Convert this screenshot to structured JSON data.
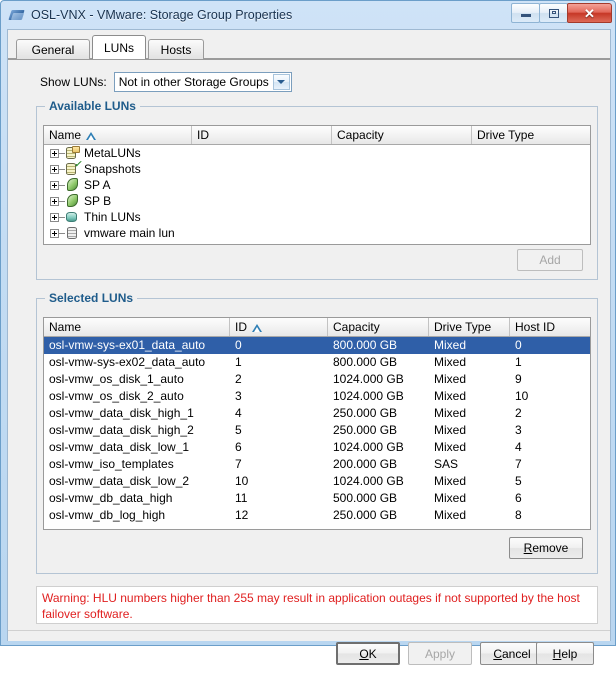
{
  "window": {
    "title": "OSL-VNX - VMware: Storage Group Properties",
    "icon": "vmware-app-icon",
    "controls": {
      "minimize": "minimize-icon",
      "maximize": "maximize-icon",
      "close": "✕"
    }
  },
  "tabs": [
    {
      "label": "General",
      "active": false
    },
    {
      "label": "LUNs",
      "active": true
    },
    {
      "label": "Hosts",
      "active": false
    }
  ],
  "show_luns": {
    "label": "Show LUNs:",
    "value": "Not in other Storage Groups",
    "arrow_icon": "chevron-down-icon"
  },
  "available": {
    "legend": "Available LUNs",
    "columns": [
      "Name",
      "ID",
      "Capacity",
      "Drive Type"
    ],
    "sorted_column": "Name",
    "sort_indicator": "ascending-triangle-icon",
    "tree": [
      {
        "label": "MetaLUNs",
        "icon": "disk-folder-icon",
        "expandable": true
      },
      {
        "label": "Snapshots",
        "icon": "disk-check-icon",
        "expandable": true
      },
      {
        "label": "SP A",
        "icon": "sp-green-icon",
        "expandable": true
      },
      {
        "label": "SP B",
        "icon": "sp-green-icon",
        "expandable": true
      },
      {
        "label": "Thin LUNs",
        "icon": "thin-lun-icon",
        "expandable": true
      },
      {
        "label": "vmware main lun",
        "icon": "disk-gray-icon",
        "expandable": true
      }
    ],
    "add_button": "Add",
    "add_button_enabled": false
  },
  "selected": {
    "legend": "Selected LUNs",
    "columns": [
      "Name",
      "ID",
      "Capacity",
      "Drive Type",
      "Host ID"
    ],
    "sorted_column": "ID",
    "sort_indicator": "ascending-triangle-icon",
    "rows": [
      {
        "name": "osl-vmw-sys-ex01_data_auto",
        "id": "0",
        "capacity": "800.000 GB",
        "drive_type": "Mixed",
        "host_id": "0",
        "selected": true
      },
      {
        "name": "osl-vmw-sys-ex02_data_auto",
        "id": "1",
        "capacity": "800.000 GB",
        "drive_type": "Mixed",
        "host_id": "1",
        "selected": false
      },
      {
        "name": "osl-vmw_os_disk_1_auto",
        "id": "2",
        "capacity": "1024.000 GB",
        "drive_type": "Mixed",
        "host_id": "9",
        "selected": false
      },
      {
        "name": "osl-vmw_os_disk_2_auto",
        "id": "3",
        "capacity": "1024.000 GB",
        "drive_type": "Mixed",
        "host_id": "10",
        "selected": false
      },
      {
        "name": "osl-vmw_data_disk_high_1",
        "id": "4",
        "capacity": "250.000 GB",
        "drive_type": "Mixed",
        "host_id": "2",
        "selected": false
      },
      {
        "name": "osl-vmw_data_disk_high_2",
        "id": "5",
        "capacity": "250.000 GB",
        "drive_type": "Mixed",
        "host_id": "3",
        "selected": false
      },
      {
        "name": "osl-vmw_data_disk_low_1",
        "id": "6",
        "capacity": "1024.000 GB",
        "drive_type": "Mixed",
        "host_id": "4",
        "selected": false
      },
      {
        "name": "osl-vmw_iso_templates",
        "id": "7",
        "capacity": "200.000 GB",
        "drive_type": "SAS",
        "host_id": "7",
        "selected": false
      },
      {
        "name": "osl-vmw_data_disk_low_2",
        "id": "10",
        "capacity": "1024.000 GB",
        "drive_type": "Mixed",
        "host_id": "5",
        "selected": false
      },
      {
        "name": "osl-vmw_db_data_high",
        "id": "11",
        "capacity": "500.000 GB",
        "drive_type": "Mixed",
        "host_id": "6",
        "selected": false
      },
      {
        "name": "osl-vmw_db_log_high",
        "id": "12",
        "capacity": "250.000 GB",
        "drive_type": "Mixed",
        "host_id": "8",
        "selected": false
      }
    ],
    "remove_button": "Remove",
    "remove_mnemonic": "R"
  },
  "warning": {
    "text": "Warning: HLU numbers higher than 255 may result in application outages if not supported by the host failover software.",
    "color": "#e02020"
  },
  "footer": {
    "ok": "OK",
    "ok_mnemonic": "O",
    "apply": "Apply",
    "apply_enabled": false,
    "cancel": "Cancel",
    "cancel_mnemonic": "C",
    "help": "Help",
    "help_mnemonic": "H"
  },
  "colors": {
    "selection_blue": "#2f5fa8",
    "legend_blue": "#1f5c8b",
    "warning_red": "#e02020",
    "titlebar_blue": "#cfe3f7"
  }
}
